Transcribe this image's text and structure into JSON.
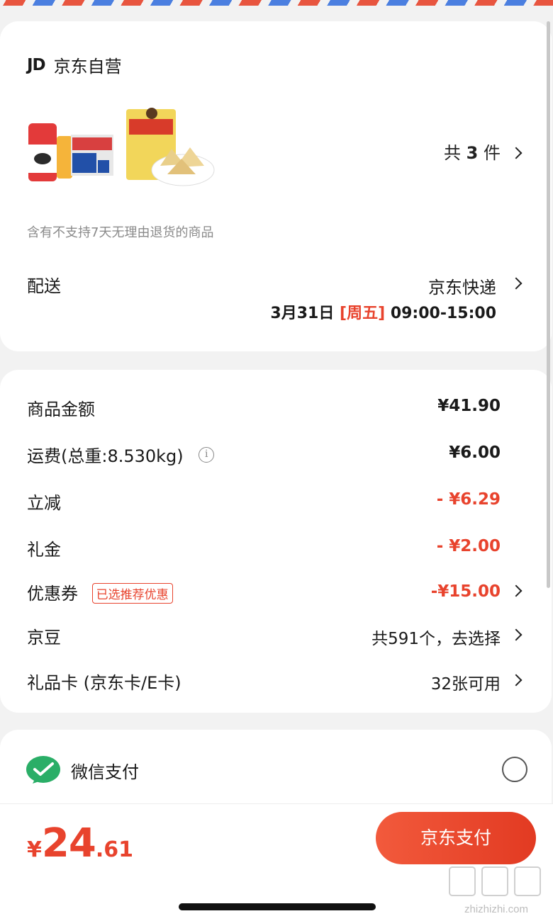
{
  "shop": {
    "logo": "JD",
    "name": "京东自营"
  },
  "items": {
    "count_prefix": "共",
    "count": "3",
    "count_suffix": "件"
  },
  "return_note": "含有不支持7天无理由退货的商品",
  "delivery": {
    "label": "配送",
    "carrier": "京东快递",
    "date": "3月31日",
    "weekday": "[周五]",
    "time": "09:00-15:00"
  },
  "costs": {
    "goods_label": "商品金额",
    "goods_value": "¥41.90",
    "shipping_label": "运费(总重:8.530kg)",
    "shipping_value": "¥6.00",
    "discount_label": "立减",
    "discount_value": "- ¥6.29",
    "gift_label": "礼金",
    "gift_value": "- ¥2.00",
    "coupon_label": "优惠券",
    "coupon_tag": "已选推荐优惠",
    "coupon_value": "-¥15.00",
    "beans_label": "京豆",
    "beans_value": "共591个，去选择",
    "giftcard_label": "礼品卡 (京东卡/E卡)",
    "giftcard_value": "32张可用"
  },
  "payment": {
    "method": "微信支付"
  },
  "total": {
    "currency": "¥",
    "integer": "24",
    "decimal": ".61"
  },
  "pay_button": "京东支付",
  "watermark": {
    "text": "zhizhizhi.com"
  },
  "colors": {
    "accent": "#e8432d",
    "wechat": "#2aae67"
  }
}
